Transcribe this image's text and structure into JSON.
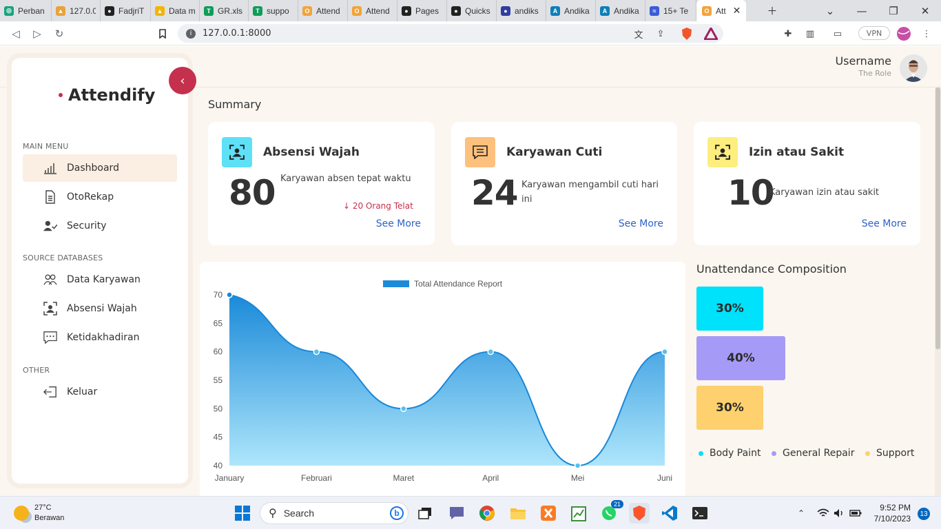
{
  "browser": {
    "tabs": [
      {
        "title": "Perban",
        "color": "#19a37f",
        "glyph": "◎"
      },
      {
        "title": "127.0.0",
        "color": "#e8a33b",
        "glyph": "▲"
      },
      {
        "title": "FadjriT",
        "color": "#222222",
        "glyph": "●"
      },
      {
        "title": "Data m",
        "color": "#f4b400",
        "glyph": "▲"
      },
      {
        "title": "GR.xls",
        "color": "#0f9d58",
        "glyph": "T"
      },
      {
        "title": "suppo",
        "color": "#0f9d58",
        "glyph": "T"
      },
      {
        "title": "Attend",
        "color": "#f2a33a",
        "glyph": "O"
      },
      {
        "title": "Attend",
        "color": "#f2a33a",
        "glyph": "O"
      },
      {
        "title": "Pages",
        "color": "#222222",
        "glyph": "●"
      },
      {
        "title": "Quicks",
        "color": "#222222",
        "glyph": "●"
      },
      {
        "title": "andiks",
        "color": "#2f3e9e",
        "glyph": "●"
      },
      {
        "title": "Andika",
        "color": "#0e7fb8",
        "glyph": "A"
      },
      {
        "title": "Andika",
        "color": "#0e7fb8",
        "glyph": "A"
      },
      {
        "title": "15+ Te",
        "color": "#3b5bdb",
        "glyph": "≈"
      }
    ],
    "active_tab": {
      "title": "Att",
      "color": "#f2a33a",
      "glyph": "O"
    },
    "url": "127.0.0.1:8000",
    "vpn_label": "VPN"
  },
  "sidebar": {
    "brand": "Attendify",
    "sections": {
      "main": "MAIN MENU",
      "source": "SOURCE DATABASES",
      "other": "OTHER"
    },
    "items": {
      "dashboard": "Dashboard",
      "otorekap": "OtoRekap",
      "security": "Security",
      "data_karyawan": "Data Karyawan",
      "absensi_wajah": "Absensi Wajah",
      "ketidakhadiran": "Ketidakhadiran",
      "keluar": "Keluar"
    }
  },
  "header": {
    "username": "Username",
    "role": "The Role"
  },
  "summary": {
    "title": "Summary",
    "cards": [
      {
        "title": "Absensi Wajah",
        "value": "80",
        "desc": "Karyawan absen tepat waktu",
        "note": "↓ 20 Orang Telat",
        "link": "See More",
        "icon_color": "#5ee0f7"
      },
      {
        "title": "Karyawan Cuti",
        "value": "24",
        "desc": "Karyawan mengambil cuti hari ini",
        "link": "See More",
        "icon_color": "#fdc17d"
      },
      {
        "title": "Izin atau Sakit",
        "value": "10",
        "desc": "Karyawan izin atau sakit",
        "link": "See More",
        "icon_color": "#fdee7e"
      }
    ]
  },
  "chart_data": {
    "type": "area",
    "legend": "Total Attendance Report",
    "categories": [
      "January",
      "Februari",
      "Maret",
      "April",
      "Mei",
      "Juni"
    ],
    "values": [
      70,
      60,
      50,
      60,
      40,
      60
    ],
    "ylim": [
      40,
      70
    ],
    "yticks": [
      70,
      65,
      60,
      55,
      50,
      45,
      40
    ],
    "color": "#1b8ad9"
  },
  "unattendance": {
    "title": "Unattendance Composition",
    "bars": [
      {
        "label": "30%",
        "value": 30,
        "color": "#00e1fb",
        "name": "Body Paint"
      },
      {
        "label": "40%",
        "value": 40,
        "color": "#a59bf7",
        "name": "General Repair"
      },
      {
        "label": "30%",
        "value": 30,
        "color": "#fed16e",
        "name": "Support"
      }
    ]
  },
  "taskbar": {
    "temp": "27°C",
    "weather": "Berawan",
    "search": "Search",
    "time": "9:52 PM",
    "date": "7/10/2023",
    "notifications": "13",
    "whatsapp_badge": "21"
  }
}
